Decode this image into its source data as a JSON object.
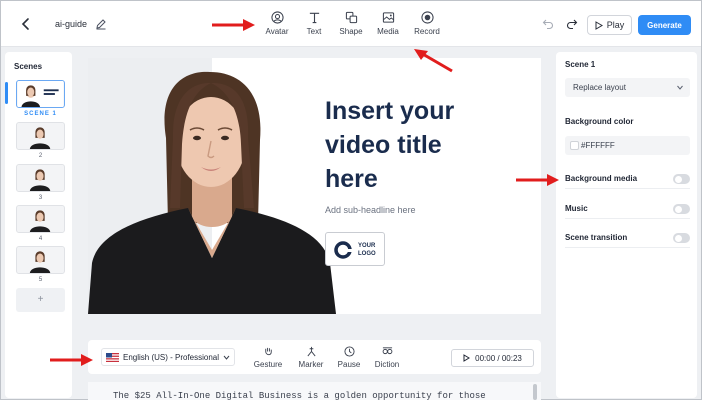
{
  "toolbar": {
    "project_name": "ai-guide",
    "tools": [
      {
        "label": "Avatar",
        "icon": "avatar-icon"
      },
      {
        "label": "Text",
        "icon": "text-icon"
      },
      {
        "label": "Shape",
        "icon": "shape-icon"
      },
      {
        "label": "Media",
        "icon": "media-icon"
      },
      {
        "label": "Record",
        "icon": "record-icon"
      }
    ],
    "play_label": "Play",
    "generate_label": "Generate"
  },
  "scenes": {
    "title": "Scenes",
    "items": [
      {
        "label": "SCENE 1",
        "active": true
      },
      {
        "label": "2",
        "active": false
      },
      {
        "label": "3",
        "active": false
      },
      {
        "label": "4",
        "active": false
      },
      {
        "label": "5",
        "active": false
      }
    ],
    "add_label": "+"
  },
  "canvas": {
    "title": "Insert your\nvideo title\nhere",
    "subtitle": "Add sub-headline here",
    "logo_text": "YOUR\nLOGO"
  },
  "controls": {
    "language": "English (US) - Professional",
    "tools": [
      {
        "label": "Gesture",
        "icon": "gesture-icon"
      },
      {
        "label": "Marker",
        "icon": "marker-icon"
      },
      {
        "label": "Pause",
        "icon": "pause-clock-icon"
      },
      {
        "label": "Diction",
        "icon": "diction-icon"
      }
    ],
    "time": "00:00 / 00:23",
    "script": "The $25 All-In-One Digital Business is a golden opportunity for those"
  },
  "right_panel": {
    "scene_title": "Scene 1",
    "layout_label": "Replace layout",
    "bg_color_label": "Background color",
    "bg_color_value": "#FFFFFF",
    "rows": [
      {
        "label": "Background media",
        "on": false
      },
      {
        "label": "Music",
        "on": false
      },
      {
        "label": "Scene transition",
        "on": false
      }
    ]
  },
  "colors": {
    "accent": "#2f8cf5",
    "annotation_arrow": "#e11d1d",
    "title_text": "#1a2c4d"
  }
}
